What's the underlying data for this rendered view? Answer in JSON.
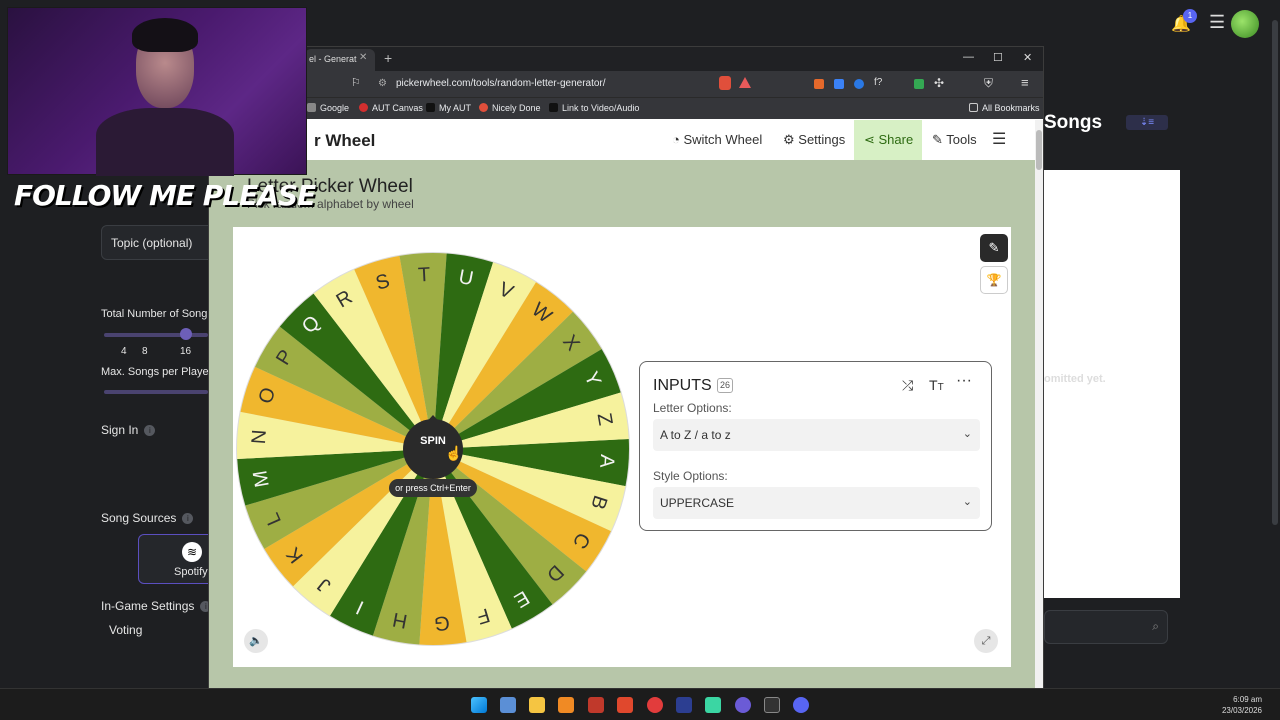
{
  "overlay": {
    "follow_text": "FOLLOW ME PLEASE"
  },
  "background_app": {
    "topic_field": "Topic (optional)",
    "total_songs_label": "Total Number of Song",
    "total_songs_ticks": [
      "4",
      "8",
      "16"
    ],
    "max_songs_label": "Max. Songs per Playe",
    "sign_in_label": "Sign In",
    "song_sources_label": "Song Sources",
    "spotify_label": "Spotify",
    "ingame_settings_label": "In-Game Settings",
    "voting_label": "Voting",
    "right_panel_title": "Songs",
    "right_panel_message": "omitted yet.",
    "notification_count": "1"
  },
  "browser": {
    "tab_title": "el - Generat",
    "url": "pickerwheel.com/tools/random-letter-generator/",
    "bookmarks": [
      "Google",
      "AUT Canvas",
      "My AUT",
      "Nicely Done",
      "Link to Video/Audio"
    ],
    "all_bookmarks": "All Bookmarks"
  },
  "site": {
    "brand": "r Wheel",
    "nav": {
      "switch_wheel": "Switch Wheel",
      "settings": "Settings",
      "share": "Share",
      "tools": "Tools"
    },
    "page_title": "Letter Picker Wheel",
    "page_subtitle": "Pick random alphabet by wheel",
    "spin_label": "SPIN",
    "spin_hint": "or press Ctrl+Enter",
    "wheel_letters": [
      "A",
      "B",
      "C",
      "D",
      "E",
      "F",
      "G",
      "H",
      "I",
      "J",
      "K",
      "L",
      "M",
      "N",
      "O",
      "P",
      "Q",
      "R",
      "S",
      "T",
      "U",
      "V",
      "W",
      "X",
      "Y",
      "Z"
    ],
    "wheel_colors": [
      "#2e6b12",
      "#f6f29d",
      "#f0b72e",
      "#9eae44"
    ],
    "inputs": {
      "title": "INPUTS",
      "count": "26",
      "letter_options_label": "Letter Options:",
      "letter_options_value": "A to Z / a to z",
      "style_options_label": "Style Options:",
      "style_options_value": "UPPERCASE"
    }
  },
  "taskbar": {
    "time": "6:09 am",
    "date": "23/03/2026"
  }
}
